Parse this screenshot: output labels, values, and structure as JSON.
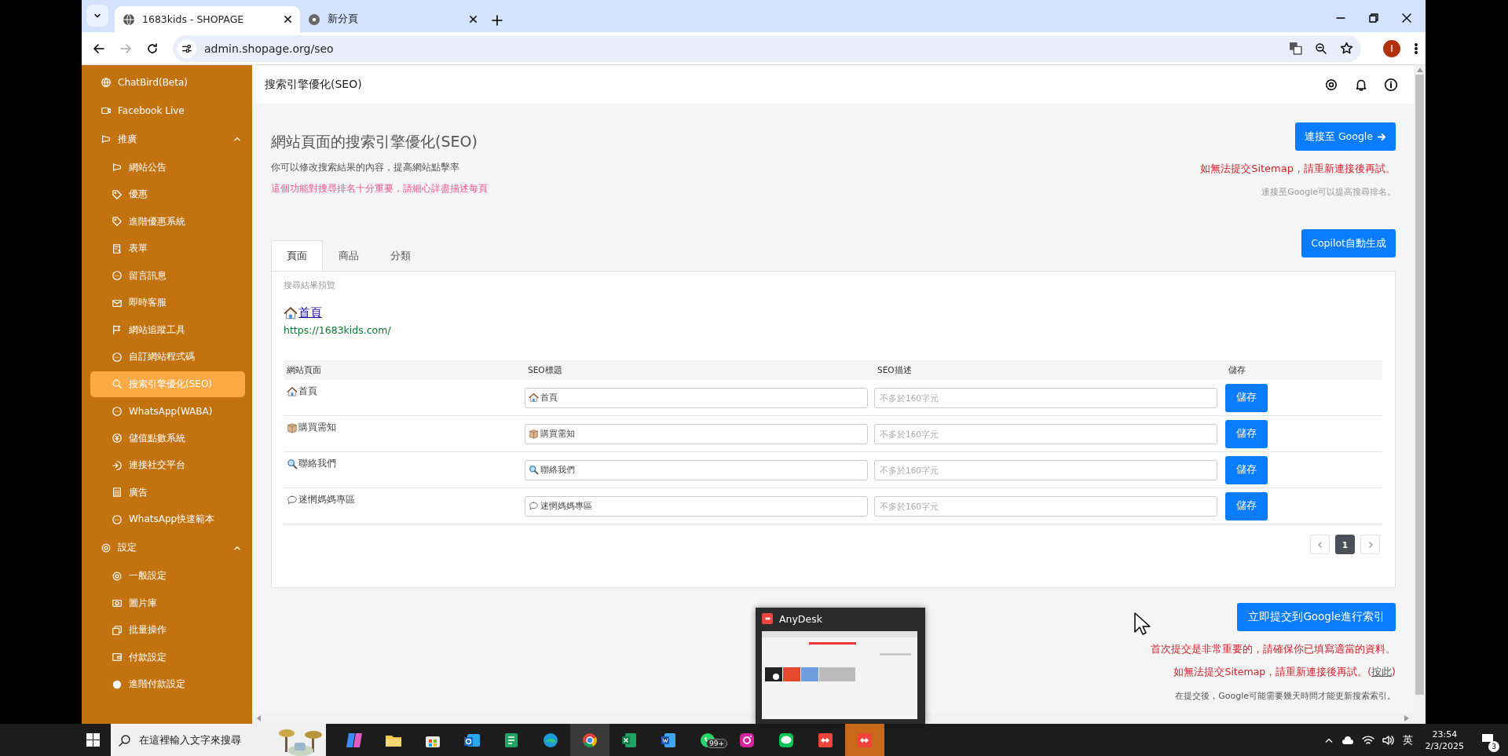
{
  "browser": {
    "tabs": [
      {
        "title": "1683kids - SHOPAGE",
        "selected": true
      },
      {
        "title": "新分頁",
        "selected": false
      }
    ],
    "url": "admin.shopage.org/seo",
    "profile": "I"
  },
  "sidebar": {
    "items": [
      {
        "label": "ChatBird(Beta)",
        "selected": false
      },
      {
        "label": "Facebook Live",
        "selected": false
      },
      {
        "label": "推廣",
        "selected": false,
        "expanded": true,
        "children": [
          {
            "label": "網站公告",
            "selected": false
          },
          {
            "label": "優惠",
            "selected": false
          },
          {
            "label": "進階優惠系統",
            "selected": false
          },
          {
            "label": "表單",
            "selected": false
          },
          {
            "label": "留言訊息",
            "selected": false
          },
          {
            "label": "即時客服",
            "selected": false
          },
          {
            "label": "網站追蹤工具",
            "selected": false
          },
          {
            "label": "自訂網站程式碼",
            "selected": false
          },
          {
            "label": "搜索引擎優化(SEO)",
            "selected": true
          },
          {
            "label": "WhatsApp(WABA)",
            "selected": false
          },
          {
            "label": "儲值點數系統",
            "selected": false
          },
          {
            "label": "連接社交平台",
            "selected": false
          },
          {
            "label": "廣告",
            "selected": false
          },
          {
            "label": "WhatsApp快速範本",
            "selected": false
          }
        ]
      },
      {
        "label": "設定",
        "selected": false,
        "expanded": true,
        "children": [
          {
            "label": "一般設定",
            "selected": false
          },
          {
            "label": "圖片庫",
            "selected": false
          },
          {
            "label": "批量操作",
            "selected": false
          },
          {
            "label": "付款設定",
            "selected": false
          },
          {
            "label": "進階付款設定",
            "selected": false
          }
        ]
      }
    ]
  },
  "page_header": {
    "title": "搜索引擎優化(SEO)"
  },
  "intro": {
    "heading": "網站頁面的搜索引擎優化(SEO)",
    "subtitle": "你可以修改搜索結果的內容，提高網站點擊率",
    "note": "這個功能對搜尋排名十分重要，請細心詳盡描述每頁"
  },
  "google": {
    "button": "連接至 Google",
    "warning": "如無法提交Sitemap，請重新連接後再試。",
    "hint": "連接至Google可以提高搜尋排名。"
  },
  "copilot_button": "Copilot自動生成",
  "tabs": [
    {
      "label": "頁面",
      "selected": true
    },
    {
      "label": "商品",
      "selected": false
    },
    {
      "label": "分類",
      "selected": false
    }
  ],
  "preview": {
    "label": "搜尋結果預覽",
    "title": "首頁",
    "url": "https://1683kids.com/"
  },
  "table": {
    "columns": [
      "網站頁面",
      "SEO標題",
      "SEO描述",
      "儲存"
    ],
    "rows": [
      {
        "page": "首頁",
        "seo_title": "首頁",
        "seo_description_placeholder": "不多於160字元",
        "save": "儲存"
      },
      {
        "page": "購買需知",
        "seo_title": "購買需知",
        "seo_description_placeholder": "不多於160字元",
        "save": "儲存"
      },
      {
        "page": "聯絡我們",
        "seo_title": "聯絡我們",
        "seo_description_placeholder": "不多於160字元",
        "save": "儲存"
      },
      {
        "page": "迷惘媽媽專區",
        "seo_title": "迷惘媽媽專區",
        "seo_description_placeholder": "不多於160字元",
        "save": "儲存"
      }
    ]
  },
  "pagination": {
    "pages": [
      {
        "label": "1",
        "selected": true
      }
    ]
  },
  "submit": {
    "button": "立即提交到Google進行索引",
    "warning": "首次提交是非常重要的，請確保你已填寫適當的資料。",
    "retry_before": "如無法提交Sitemap，請重新連接後再試。(",
    "retry_link": "按此",
    "retry_after": ")",
    "note": "在提交後，Google可能需要幾天時間才能更新搜索索引。"
  },
  "anydesk_popup": {
    "title": "AnyDesk"
  },
  "taskbar": {
    "search_placeholder": "在這裡輸入文字來搜尋",
    "apps": [
      {
        "active": false,
        "flashing": false
      },
      {
        "active": false,
        "flashing": false
      },
      {
        "active": false,
        "flashing": false
      },
      {
        "active": false,
        "flashing": false
      },
      {
        "active": false,
        "flashing": false
      },
      {
        "active": false,
        "flashing": false
      },
      {
        "active": true,
        "flashing": false
      },
      {
        "active": false,
        "flashing": false
      },
      {
        "active": false,
        "flashing": false
      },
      {
        "active": false,
        "flashing": false,
        "badge": "99+"
      },
      {
        "active": false,
        "flashing": false
      },
      {
        "active": false,
        "flashing": false
      },
      {
        "active": false,
        "flashing": false
      },
      {
        "active": false,
        "flashing": true
      }
    ],
    "language": "英",
    "time": "23:54",
    "date": "2/3/2025",
    "notifications": "3"
  }
}
